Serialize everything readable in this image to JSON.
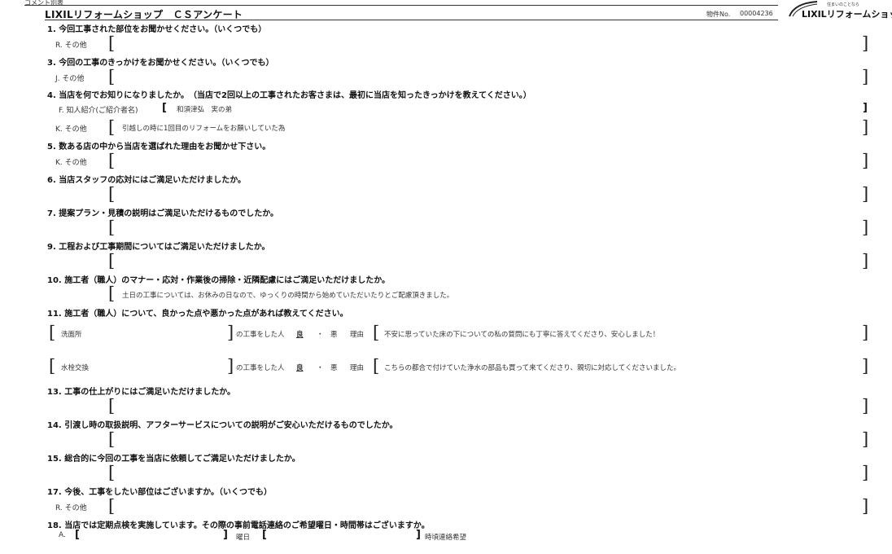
{
  "top_label": "コメント別表",
  "header": {
    "title": "LIXILリフォームショップ　ＣＳアンケート",
    "property_label": "物件No.",
    "property_no": "00004236",
    "logo_tagline": "住まいのことなら",
    "logo_text": "LIXILリフォームショップ"
  },
  "q1": {
    "text": "1.  今回工事された部位をお聞かせください。（いくつでも）",
    "option": "R.  その他",
    "answer": ""
  },
  "q3": {
    "text": "3.  今回の工事のきっかけをお聞かせください。（いくつでも）",
    "option": "J.  その他",
    "answer": ""
  },
  "q4": {
    "text": "4.  当店を何でお知りになりましたか。　（当店で2回以上の工事されたお客さまは、最初に当店を知ったきっかけを教えてください。）",
    "opt_f": "F.  知人紹介(ご紹介者名)",
    "answer_f": "和須津弘　実の弟",
    "opt_k": "K.  その他",
    "answer_k": "引越しの時に1回目のリフォームをお願いしていた為"
  },
  "q5": {
    "text": "5.  数ある店の中から当店を選ばれた理由をお聞かせ下さい。",
    "option": "K.  その他",
    "answer": ""
  },
  "q6": {
    "text": "6.  当店スタッフの応対にはご満足いただけましたか。",
    "answer": ""
  },
  "q7": {
    "text": "7.  提案プラン・見積の説明はご満足いただけるものでしたか。",
    "answer": ""
  },
  "q9": {
    "text": "9.  工程および工事期間についてはご満足いただけましたか。",
    "answer": ""
  },
  "q10": {
    "text": "10.  施工者（職人）のマナー・応対・作業後の掃除・近隣配慮にはご満足いただけましたか。",
    "answer": "土日の工事については、お休みの日なので、ゆっくりの時間から始めていただいたりとご配慮頂きました。"
  },
  "q11": {
    "text": "11.  施工者（職人）について、良かった点や悪かった点があれば教えてください。",
    "rows": [
      {
        "work": "洗面所",
        "suffix": "の工事をした人",
        "good": "良",
        "sep": "・",
        "bad": "悪",
        "reason_label": "理由",
        "reason": "不安に思っていた床の下についての私の質問にも丁寧に答えてくださり、安心しました！"
      },
      {
        "work": "水栓交換",
        "suffix": "の工事をした人",
        "good": "良",
        "sep": "・",
        "bad": "悪",
        "reason_label": "理由",
        "reason": "こちらの都合で付けていた浄水の部品も買って来てくださり、親切に対応してくださいました。"
      }
    ]
  },
  "q13": {
    "text": "13.  工事の仕上がりにはご満足いただけましたか。",
    "answer": ""
  },
  "q14": {
    "text": "14.  引渡し時の取扱説明、アフターサービスについての説明がご安心いただけるものでしたか。",
    "answer": ""
  },
  "q15": {
    "text": "15.  総合的に今回の工事を当店に依頼してご満足いただけましたか。",
    "answer": ""
  },
  "q17": {
    "text": "17.  今後、工事をしたい部位はございますか。（いくつでも）",
    "option": "R.  その他",
    "answer": ""
  },
  "q18": {
    "text": "18.  当店では定期点検を実施しています。その際の事前電話連絡のご希望曜日・時間帯はございますか。",
    "option": "A.",
    "day_label": "曜日",
    "time_label": "時頃連絡希望"
  },
  "bracket_open": "[",
  "bracket_close": "]"
}
